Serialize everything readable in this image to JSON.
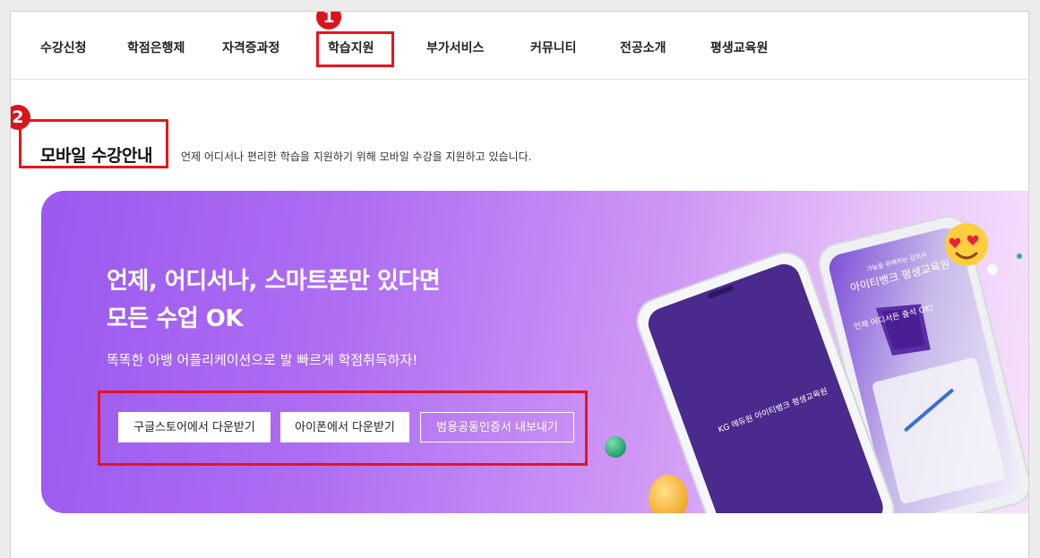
{
  "nav": {
    "items": [
      "수강신청",
      "학점은행제",
      "자격증과정",
      "학습지원",
      "부가서비스",
      "커뮤니티",
      "전공소개",
      "평생교육원"
    ]
  },
  "callouts": {
    "one": "1",
    "two": "2"
  },
  "section": {
    "title": "모바일 수강안내",
    "subtitle": "언제 어디서나 편리한 학습을 지원하기 위해 모바일 수강을 지원하고 있습니다."
  },
  "banner": {
    "headline_line1": "언제, 어디서나, 스마트폰만 있다면",
    "headline_line2": "모든 수업 OK",
    "tagline": "똑똑한 아뱅 어플리케이션으로 발 빠르게 학점취득하자!",
    "buttons": {
      "google": "구글스토어에서 다운받기",
      "iphone": "아이폰에서 다운받기",
      "cert": "범용공동인증서 내보내기"
    },
    "phone_front_logo": "KG 에듀원 아이티뱅크 평생교육원",
    "phone_back_caption": "아이티뱅크 평생교육원",
    "phone_back_small": "가능을 위해하는 강의시",
    "phone_bubble": "언제 어디서든 출석 OK!"
  },
  "colors": {
    "accent_red": "#e8141c",
    "banner_start": "#9b59f0",
    "banner_end": "#f7e3fb",
    "phone_screen": "#4a2a8c"
  },
  "icons": [
    "emoji-heart-eyes-icon",
    "lightbulb-icon",
    "green-sphere-icon",
    "bubble-dot-icon"
  ]
}
